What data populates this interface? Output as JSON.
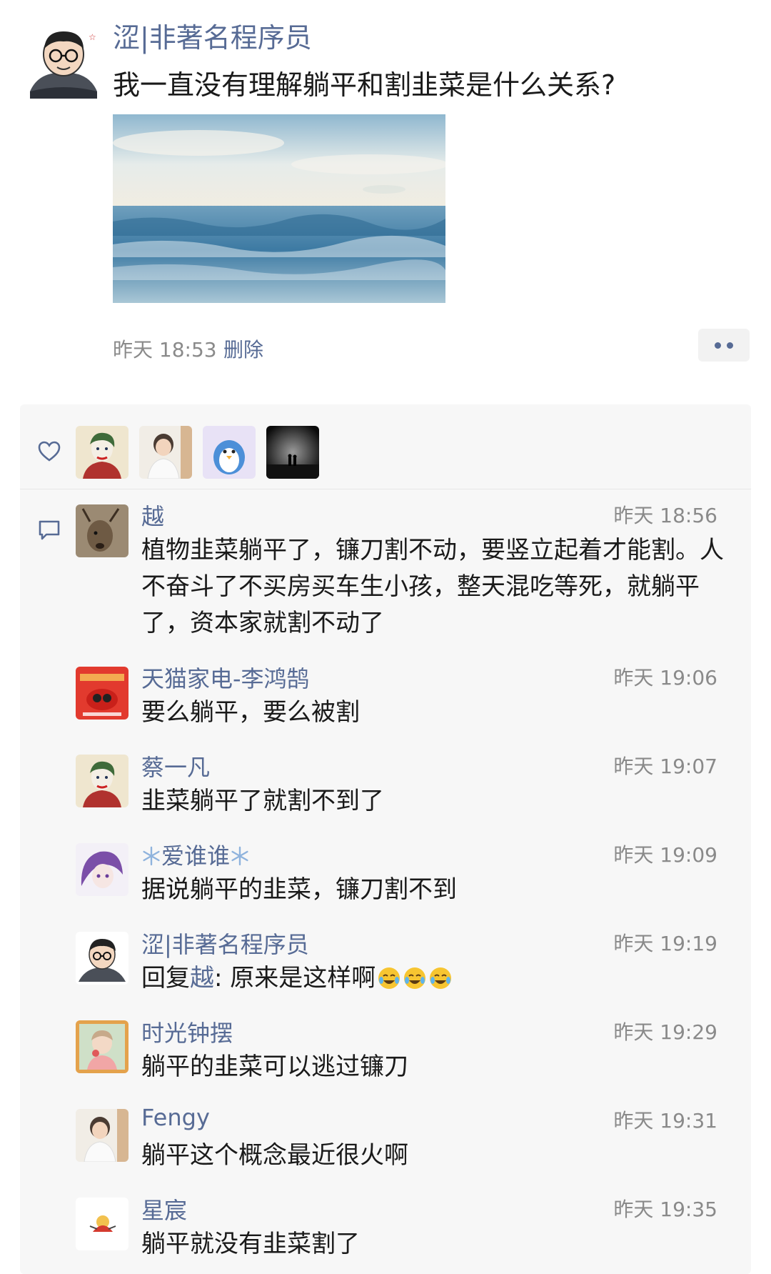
{
  "post": {
    "author": "涩|非著名程序员",
    "text": "我一直没有理解躺平和割韭菜是什么关系?",
    "time": "昨天 18:53",
    "delete_label": "删除"
  },
  "likes": {
    "icon": "heart-icon",
    "avatars": [
      "joker-avatar",
      "kid-avatar",
      "penguin-avatar",
      "silhouette-avatar"
    ]
  },
  "comments": [
    {
      "name": "越",
      "time": "昨天 18:56",
      "text": "植物韭菜躺平了，镰刀割不动，要竖立起着才能割。人不奋斗了不买房买车生小孩，整天混吃等死，就躺平了，资本家就割不动了"
    },
    {
      "name": "天猫家电-李鸿鹄",
      "time": "昨天 19:06",
      "text": "要么躺平，要么被割"
    },
    {
      "name": "蔡一凡",
      "time": "昨天 19:07",
      "text": "韭菜躺平了就割不到了"
    },
    {
      "name": "爱谁谁",
      "time": "昨天 19:09",
      "text": "据说躺平的韭菜，镰刀割不到"
    },
    {
      "name": "涩|非著名程序员",
      "time": "昨天 19:19",
      "reply_prefix": "回复",
      "reply_target": "越",
      "text": ": 原来是这样啊"
    },
    {
      "name": "时光钟摆",
      "time": "昨天 19:29",
      "text": "躺平的韭菜可以逃过镰刀"
    },
    {
      "name": "Fengy",
      "time": "昨天 19:31",
      "text": "躺平这个概念最近很火啊"
    },
    {
      "name": "星宸",
      "time": "昨天 19:35",
      "text": "躺平就没有韭菜割了"
    }
  ],
  "colors": {
    "link": "#576b95",
    "panel": "#f7f7f7",
    "text": "#1a1a1a",
    "muted": "#8a8a8a"
  }
}
